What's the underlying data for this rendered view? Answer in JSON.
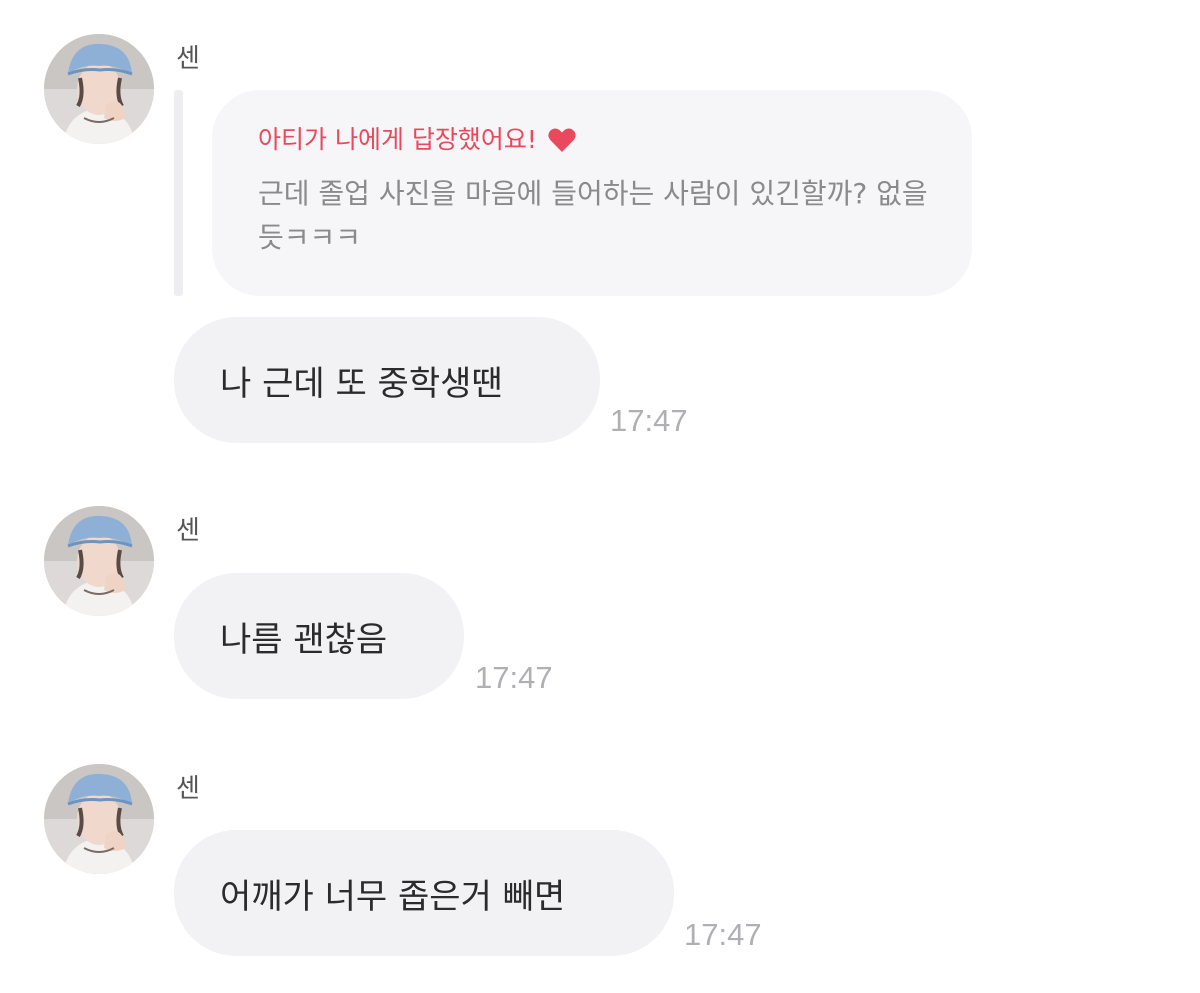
{
  "messages": [
    {
      "sender": "센",
      "avatar_icon": "profile-photo-avatar",
      "reply": {
        "header": "아티가 나에게 답장했어요!",
        "heart_icon": "heart-icon",
        "heart_color": "#e8495d",
        "quoted_text": "근데 졸업 사진을 마음에 들어하는 사람이 있긴할까? 없을듯ㅋㅋㅋ"
      },
      "text": "나 근데 또 중학생땐",
      "time": "17:47"
    },
    {
      "sender": "센",
      "avatar_icon": "profile-photo-avatar",
      "text": "나름 괜찮음",
      "time": "17:47"
    },
    {
      "sender": "센",
      "avatar_icon": "profile-photo-avatar",
      "text": "어깨가 너무 좁은거 빼면",
      "time": "17:47"
    }
  ],
  "colors": {
    "reply_accent": "#e8495d",
    "bubble_bg": "#f2f2f5",
    "time_text": "#b0b0b4"
  }
}
